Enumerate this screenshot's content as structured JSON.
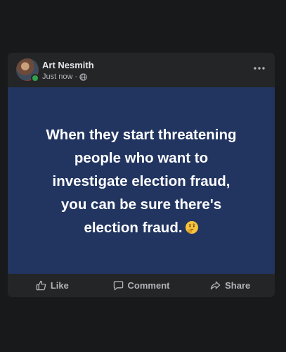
{
  "post": {
    "author": "Art Nesmith",
    "timestamp": "Just now",
    "separator": "·",
    "privacy_icon": "globe-icon",
    "more_icon": "more-options-icon",
    "body_lines": [
      "When they start threatening",
      "people who want to",
      "investigate election fraud,",
      "you can be sure there's",
      "election fraud."
    ],
    "emoji": "thinking-face-emoji",
    "background_color": "#223561"
  },
  "actions": {
    "like_label": "Like",
    "comment_label": "Comment",
    "share_label": "Share"
  },
  "colors": {
    "page_background": "#18191a",
    "card_background": "#242526",
    "online_status": "#31a24c",
    "text_primary": "#e4e6eb",
    "text_secondary": "#b0b3b8"
  }
}
